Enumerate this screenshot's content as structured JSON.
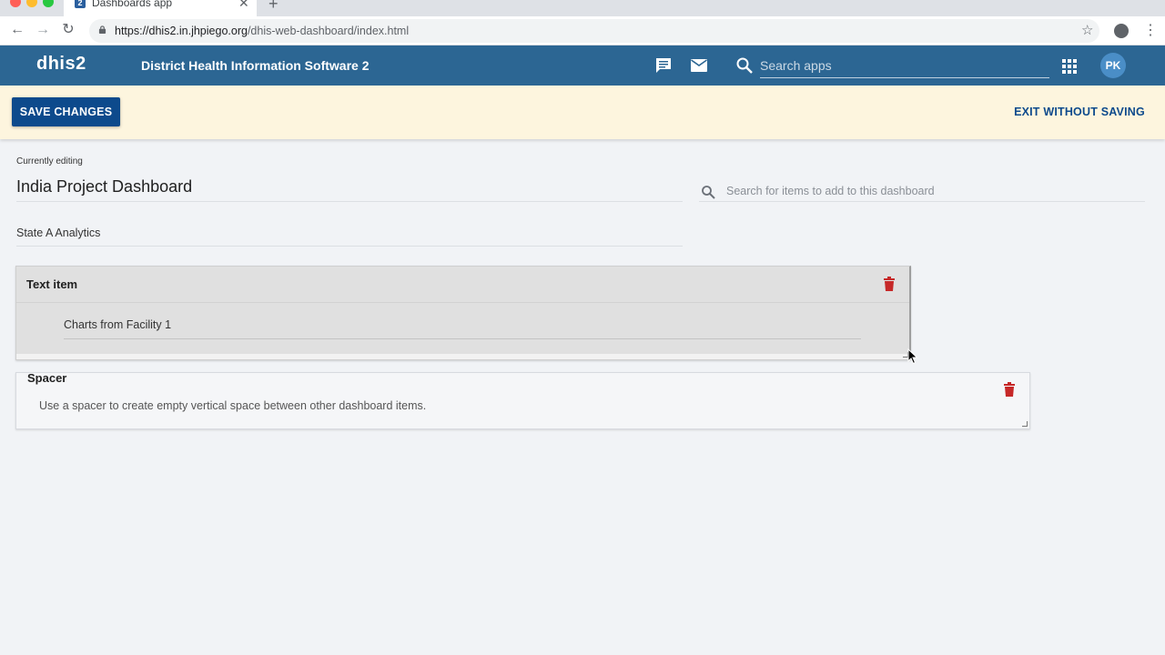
{
  "browser": {
    "tab_title": "Dashboards app",
    "tab_favicon": "2",
    "url_host": "https://dhis2.in.jhpiego.org",
    "url_path": "/dhis-web-dashboard/index.html"
  },
  "header": {
    "logo": "dhis2",
    "title": "District Health Information Software 2",
    "search_placeholder": "Search apps",
    "avatar_initials": "PK",
    "bar_color": "#2c6693"
  },
  "editbar": {
    "save_label": "SAVE CHANGES",
    "exit_label": "EXIT WITHOUT SAVING",
    "bg_color": "#fdf5de",
    "accent": "#0d4a8c"
  },
  "editor": {
    "currently_editing_label": "Currently editing",
    "dashboard_title": "India Project Dashboard",
    "dashboard_description": "State A Analytics",
    "item_search_placeholder": "Search for items to add to this dashboard"
  },
  "items": [
    {
      "type": "text",
      "title": "Text item",
      "text": "Charts from Facility 1"
    },
    {
      "type": "spacer",
      "title": "Spacer",
      "description": "Use a spacer to create empty vertical space between other dashboard items."
    }
  ],
  "icons": {
    "delete": "trash-icon",
    "delete_color": "#c62828"
  }
}
